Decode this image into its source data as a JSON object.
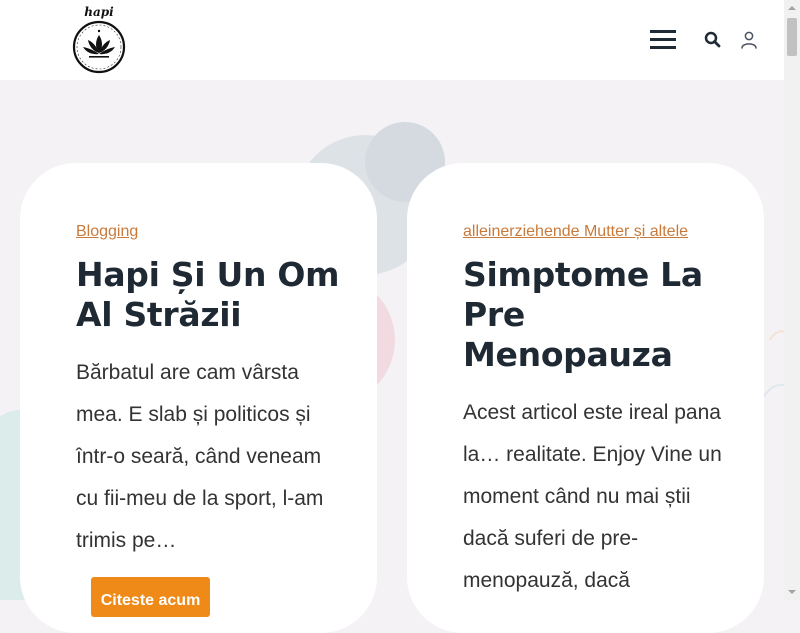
{
  "header": {
    "logo_text": "hapi",
    "icons": [
      "menu-icon",
      "search-icon",
      "user-icon"
    ]
  },
  "posts": [
    {
      "category": "Blogging",
      "title": "Hapi Și Un Om Al Străzii",
      "excerpt": "Bărbatul are cam vârsta mea. E slab și politicos și într-o seară, când veneam cu fii-meu de la sport, l-am trimis pe…",
      "read_more": "Citeste acum"
    },
    {
      "category": "alleinerziehende Mutter și altele",
      "title": "Simptome La Pre Menopauza",
      "excerpt": "Acest articol este ireal pana la… realitate. Enjoy Vine un moment când nu mai știi dacă suferi de pre- menopauză, dacă"
    }
  ],
  "colors": {
    "accent": "#ef8a18",
    "category_link": "#c97a3a",
    "page_bg": "#f5f2f5",
    "card_bg": "#ffffff",
    "heading": "#1f2933"
  }
}
